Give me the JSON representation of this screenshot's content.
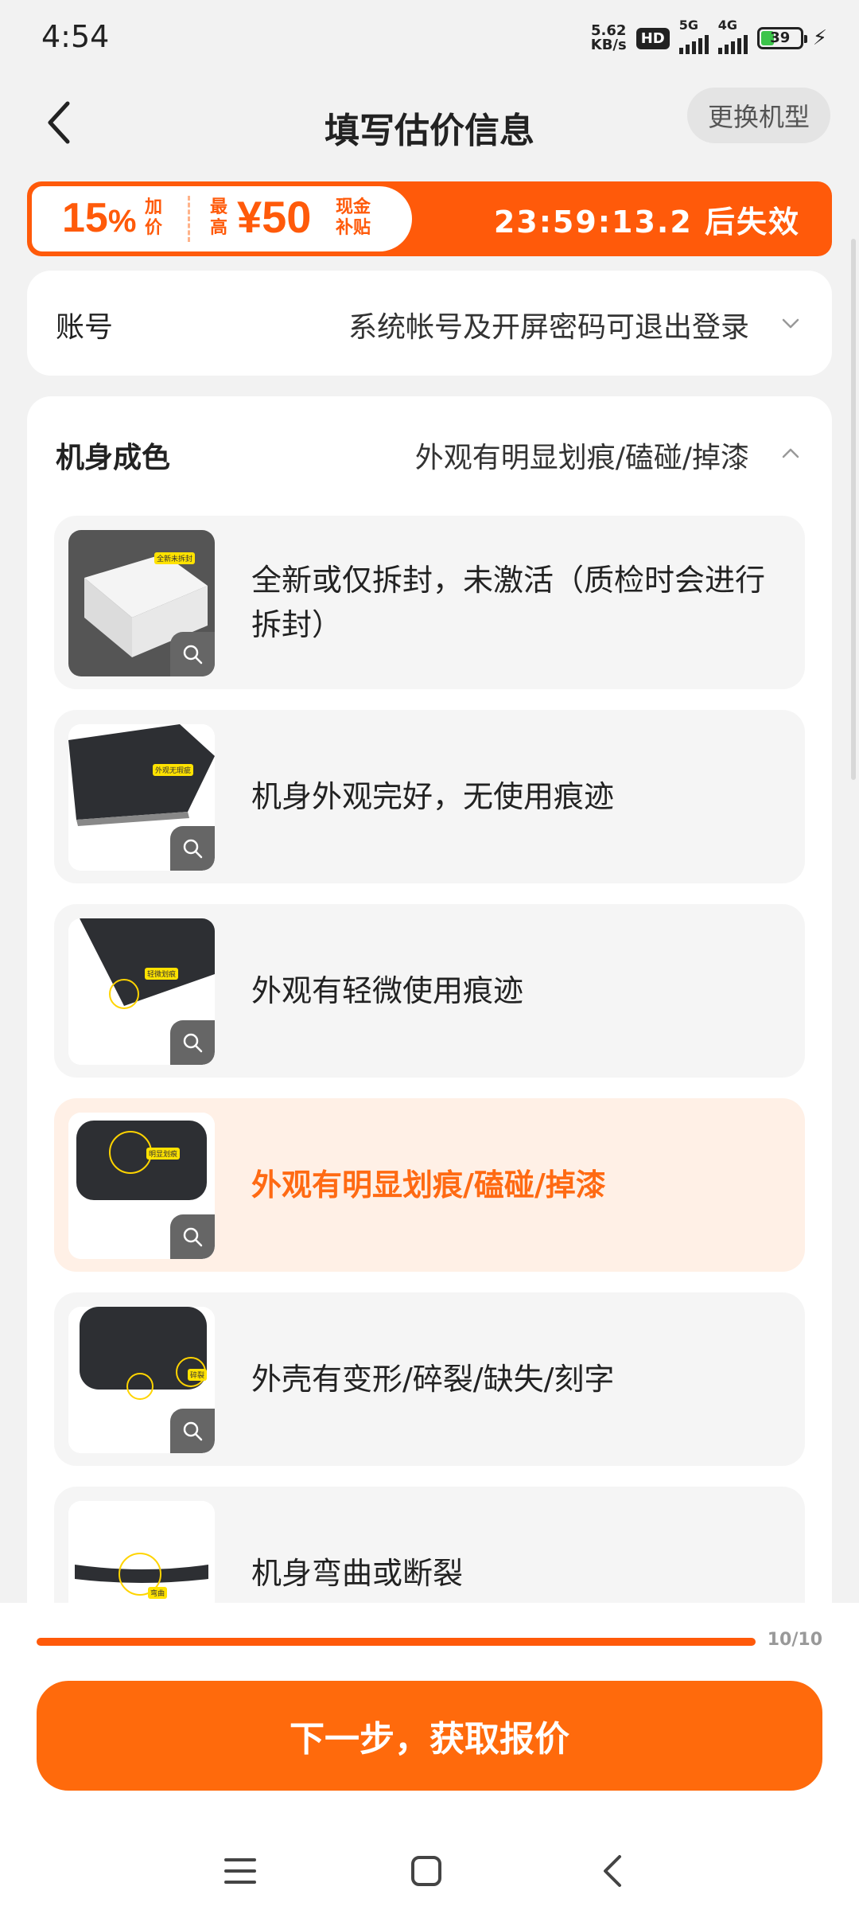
{
  "status_bar": {
    "time": "4:54",
    "net_speed_value": "5.62",
    "net_speed_unit": "KB/s",
    "hd_label": "HD",
    "sim1_label": "5G",
    "sim2_label": "4G",
    "battery_level": "39"
  },
  "header": {
    "title": "填写估价信息",
    "change_model_label": "更换机型"
  },
  "promo": {
    "percent_value": "15",
    "percent_sign": "%",
    "percent_text_top": "加",
    "percent_text_bottom": "价",
    "max_text_top": "最",
    "max_text_bottom": "高",
    "amount": "¥50",
    "cash_text_top": "现金",
    "cash_text_bottom": "补贴",
    "countdown": "23:59:13.2 后失效",
    "color": "#ff5a0a"
  },
  "account": {
    "label": "账号",
    "value": "系统帐号及开屏密码可退出登录",
    "chevron_icon": "chevron-down-icon"
  },
  "condition": {
    "label": "机身成色",
    "value": "外观有明显划痕/磕碰/掉漆",
    "chevron_icon": "chevron-up-icon",
    "options": [
      {
        "text": "全新或仅拆封，未激活（质检时会进行拆封）",
        "selected": false,
        "tag": "全新未拆封"
      },
      {
        "text": "机身外观完好，无使用痕迹",
        "selected": false,
        "tag": "外观无瑕疵"
      },
      {
        "text": "外观有轻微使用痕迹",
        "selected": false,
        "tag": "轻微划痕"
      },
      {
        "text": "外观有明显划痕/磕碰/掉漆",
        "selected": true,
        "tag": "明显划痕"
      },
      {
        "text": "外壳有变形/碎裂/缺失/刻字",
        "selected": false,
        "tag": "碎裂"
      },
      {
        "text": "机身弯曲或断裂",
        "selected": false,
        "tag": "弯曲"
      }
    ]
  },
  "progress": {
    "fraction": 1.0,
    "text": "10/10"
  },
  "footer": {
    "next_button": "下一步，获取报价"
  },
  "nav": {
    "menu_icon": "menu-icon",
    "home_icon": "home-icon",
    "back_icon": "back-icon"
  },
  "colors": {
    "accent": "#ff6a0c",
    "selected_bg": "#fff0e6",
    "selected_text": "#ff6a13"
  }
}
